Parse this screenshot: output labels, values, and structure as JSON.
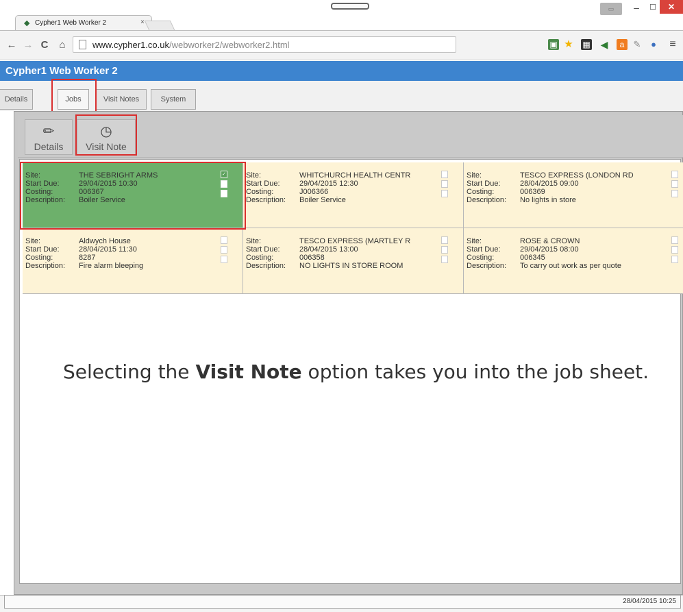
{
  "browser": {
    "tab_title": "Cypher1 Web Worker 2",
    "tab_close": "×",
    "url_host": "www.cypher1.co.uk",
    "url_path": "/webworker2/webworker2.html"
  },
  "app": {
    "title": "Cypher1 Web Worker 2",
    "tabs": [
      {
        "label": "Details"
      },
      {
        "label": "Jobs"
      },
      {
        "label": "Visit Notes"
      },
      {
        "label": "System"
      }
    ],
    "ribbon": {
      "details_label": "Details",
      "visit_note_label": "Visit Note"
    },
    "field_labels": {
      "site": "Site:",
      "start_due": "Start Due:",
      "costing": "Costing:",
      "description": "Description:"
    },
    "jobs": [
      {
        "site": "THE SEBRIGHT ARMS",
        "start_due": "29/04/2015 10:30",
        "costing": "006367",
        "description": "Boiler Service",
        "selected": true
      },
      {
        "site": "WHITCHURCH HEALTH CENTR",
        "start_due": "29/04/2015 12:30",
        "costing": "J006366",
        "description": "Boiler Service",
        "selected": false
      },
      {
        "site": "TESCO EXPRESS (LONDON RD",
        "start_due": "28/04/2015 09:00",
        "costing": "006369",
        "description": "No lights in store",
        "selected": false
      },
      {
        "site": "Aldwych House",
        "start_due": "28/04/2015 11:30",
        "costing": "8287",
        "description": "Fire alarm bleeping",
        "selected": false
      },
      {
        "site": "TESCO EXPRESS (MARTLEY R",
        "start_due": "28/04/2015 13:00",
        "costing": "006358",
        "description": "NO LIGHTS IN STORE ROOM",
        "selected": false
      },
      {
        "site": "ROSE & CROWN",
        "start_due": "29/04/2015 08:00",
        "costing": "006345",
        "description": "To carry out work as per quote",
        "selected": false
      }
    ],
    "status_date": "28/04/2015 10:25"
  },
  "caption": {
    "before": "Selecting the ",
    "bold": "Visit Note",
    "after": " option takes you into the job sheet."
  },
  "colors": {
    "header_blue": "#3d84cf",
    "selected_card": "#6db06b",
    "card_bg": "#fdf3d6",
    "highlight_red": "#d92e2e"
  }
}
